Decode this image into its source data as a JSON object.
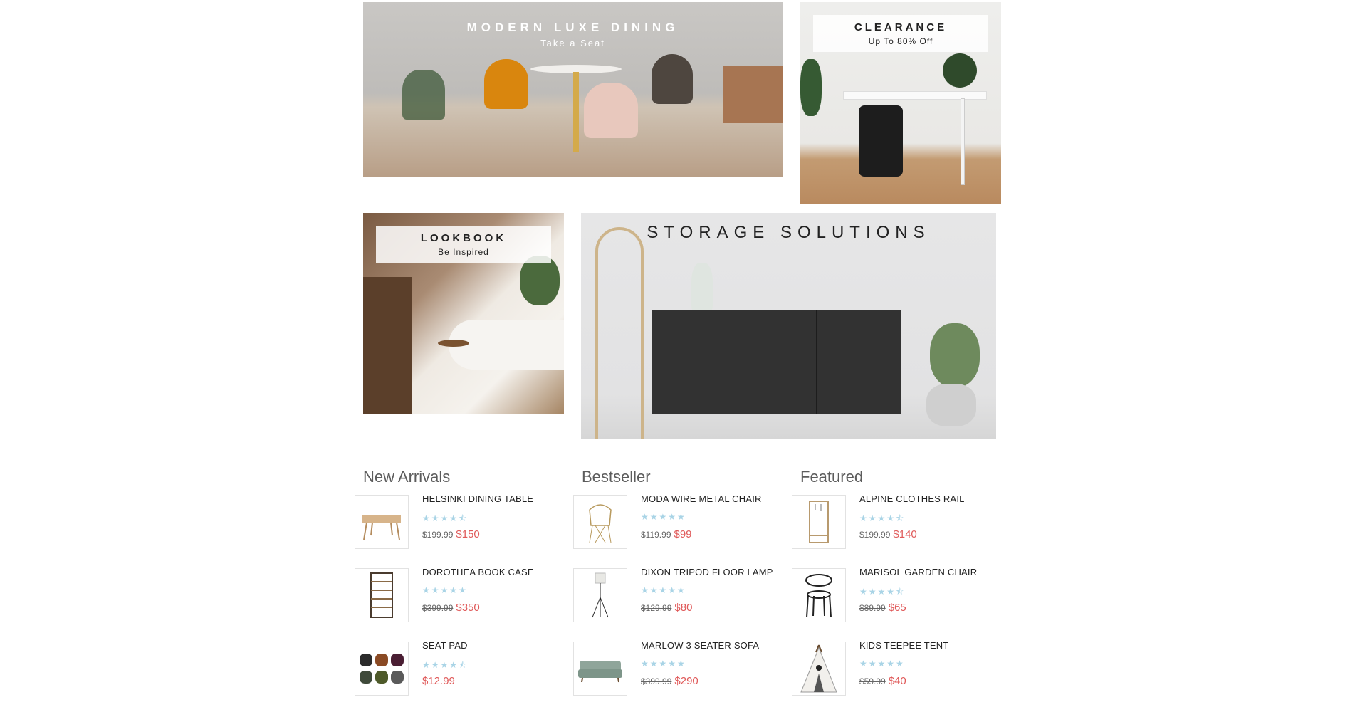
{
  "banners": {
    "dining": {
      "title": "MODERN LUXE DINING",
      "subtitle": "Take a Seat"
    },
    "clearance": {
      "title": "CLEARANCE",
      "subtitle": "Up To 80% Off"
    },
    "lookbook": {
      "title": "LOOKBOOK",
      "subtitle": "Be Inspired"
    },
    "storage": {
      "title": "STORAGE SOLUTIONS"
    }
  },
  "columns": [
    {
      "heading": "New Arrivals",
      "items": [
        {
          "name": "HELSINKI DINING TABLE",
          "rating": 4.5,
          "stars": "★★★★⯪",
          "old_price": "$199.99",
          "price": "$150",
          "icon": "table-icon"
        },
        {
          "name": "DOROTHEA BOOK CASE",
          "rating": 5,
          "stars": "★★★★★",
          "old_price": "$399.99",
          "price": "$350",
          "icon": "bookcase-icon"
        },
        {
          "name": "SEAT PAD",
          "rating": 4.5,
          "stars": "★★★★⯪",
          "old_price": "",
          "price": "$12.99",
          "icon": "seat-pad-icon"
        }
      ]
    },
    {
      "heading": "Bestseller",
      "items": [
        {
          "name": "MODA WIRE METAL CHAIR",
          "rating": 5,
          "stars": "★★★★★",
          "old_price": "$119.99",
          "price": "$99",
          "icon": "wire-chair-icon"
        },
        {
          "name": "DIXON TRIPOD FLOOR LAMP",
          "rating": 5,
          "stars": "★★★★★",
          "old_price": "$129.99",
          "price": "$80",
          "icon": "floor-lamp-icon"
        },
        {
          "name": "MARLOW 3 SEATER SOFA",
          "rating": 5,
          "stars": "★★★★★",
          "old_price": "$399.99",
          "price": "$290",
          "icon": "sofa-icon"
        }
      ]
    },
    {
      "heading": "Featured",
      "items": [
        {
          "name": "ALPINE CLOTHES RAIL",
          "rating": 4.5,
          "stars": "★★★★⯪",
          "old_price": "$199.99",
          "price": "$140",
          "icon": "clothes-rail-icon"
        },
        {
          "name": "MARISOL GARDEN CHAIR",
          "rating": 4.5,
          "stars": "★★★★⯪",
          "old_price": "$89.99",
          "price": "$65",
          "icon": "garden-chair-icon"
        },
        {
          "name": "KIDS TEEPEE TENT",
          "rating": 5,
          "stars": "★★★★★",
          "old_price": "$59.99",
          "price": "$40",
          "icon": "teepee-icon"
        }
      ]
    }
  ]
}
